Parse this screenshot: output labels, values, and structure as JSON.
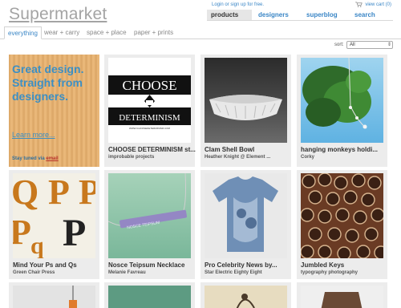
{
  "header": {
    "logo": "Supermarket",
    "account_text": "Login or sign up for free.",
    "cart_text": "view cart (0)",
    "nav": [
      "products",
      "designers",
      "superblog",
      "search"
    ]
  },
  "categories": [
    "everything",
    "wear + carry",
    "space + place",
    "paper + prints"
  ],
  "sort": {
    "label": "sort:",
    "value": "All"
  },
  "promo": {
    "headline": "Great design. Straight from designers.",
    "learn_more": "Learn more...",
    "stay_prefix": "Stay tuned via",
    "stay_link": "email"
  },
  "products": [
    {
      "title": "CHOOSE DETERMINISM st...",
      "designer": "improbable projects",
      "poster_top": "CHOOSE",
      "poster_bottom": "DETERMINISM",
      "poster_caption": "WWW.CHOOSEDETERMINISM.COM"
    },
    {
      "title": "Clam Shell Bowl",
      "designer": "Heather Knight @ Element ..."
    },
    {
      "title": "hanging monkeys holdi...",
      "designer": "Corky"
    },
    {
      "title": "Mind Your Ps and Qs",
      "designer": "Green Chair Press"
    },
    {
      "title": "Nosce Teipsum Necklace",
      "designer": "Melanie Favreau",
      "engraving": "NOSCE TEIPSUM"
    },
    {
      "title": "Pro Celebrity News by...",
      "designer": "Star Electric Eighty Eight"
    },
    {
      "title": "Jumbled Keys",
      "designer": "typography photography"
    }
  ],
  "colors": {
    "link": "#3a86c6",
    "logo": "#a4a4a4",
    "cell": "#ececec"
  }
}
